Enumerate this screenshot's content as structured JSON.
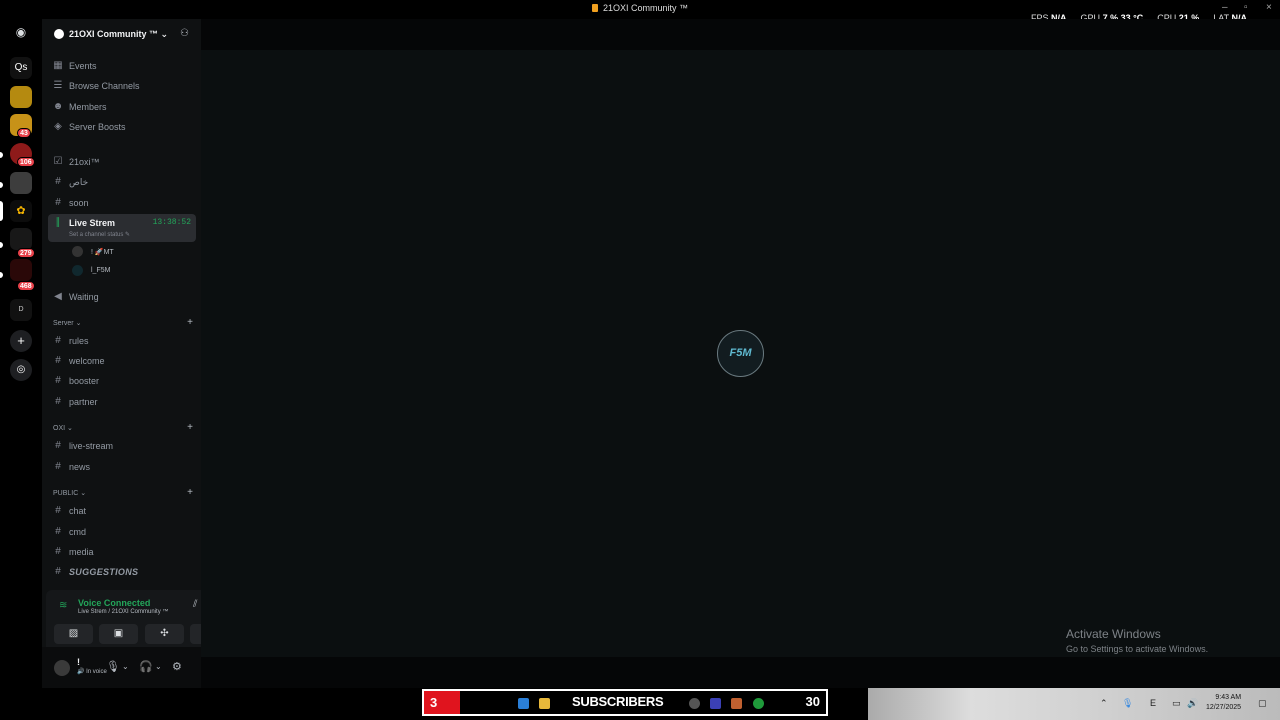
{
  "window": {
    "title": "21OXI Community ™"
  },
  "perf": {
    "fps_label": "FPS",
    "fps_value": "N/A",
    "gpu_label": "GPU",
    "gpu_value": "7 %",
    "gpu_temp": "33 °C",
    "cpu_label": "CPU",
    "cpu_value": "21 %",
    "lat_label": "LAT",
    "lat_value": "N/A"
  },
  "rail": {
    "home_icon": "discord-icon",
    "items": [
      {
        "name": "server-qs",
        "label": "Qs"
      },
      {
        "name": "server-2",
        "badge": ""
      },
      {
        "name": "server-3",
        "badge": "43"
      },
      {
        "name": "server-4",
        "badge": "106"
      },
      {
        "name": "server-5",
        "badge": ""
      },
      {
        "name": "server-6",
        "badge": ""
      },
      {
        "name": "server-7",
        "badge": "279"
      },
      {
        "name": "server-8",
        "badge": "468"
      },
      {
        "name": "server-9",
        "badge": ""
      }
    ]
  },
  "server": {
    "name": "21OXI Community ™"
  },
  "nav": {
    "events": "Events",
    "browse": "Browse Channels",
    "members": "Members",
    "boosts": "Server Boosts"
  },
  "channels": {
    "top": [
      {
        "name": "21oxi™"
      },
      {
        "name": "خاص"
      },
      {
        "name": "soon"
      }
    ],
    "live": {
      "name": "Live Strem",
      "timer": "13:38:52",
      "status": "Set a channel status"
    },
    "voice_users": [
      {
        "name": "! 🚀MT"
      },
      {
        "name": "l_F5M"
      }
    ],
    "waiting": "Waiting",
    "cat_server": "Server",
    "server_channels": [
      "rules",
      "welcome",
      "booster",
      "partner"
    ],
    "cat_oxi": "OXI",
    "oxi_channels": [
      "live-stream",
      "news"
    ],
    "cat_public": "PUBLIC",
    "public_channels": [
      "chat",
      "cmd",
      "media",
      "SUGGESTIONS"
    ]
  },
  "voice": {
    "state": "Voice Connected",
    "where": "Live Strem / 21OXI Community ™"
  },
  "user": {
    "name": "!",
    "status": "In voice"
  },
  "stream": {
    "logo": "F5M"
  },
  "activate": {
    "title": "Activate Windows",
    "sub": "Go to Settings to activate Windows."
  },
  "taskbar": {
    "sub_count": "3",
    "sub_label": "SUBSCRIBERS",
    "sub_goal": "30",
    "time": "9:43 AM",
    "date": "12/27/2025"
  },
  "colors": {
    "accent_green": "#23a55a",
    "badge_red": "#e8414a",
    "sub_red": "#e0141e"
  }
}
